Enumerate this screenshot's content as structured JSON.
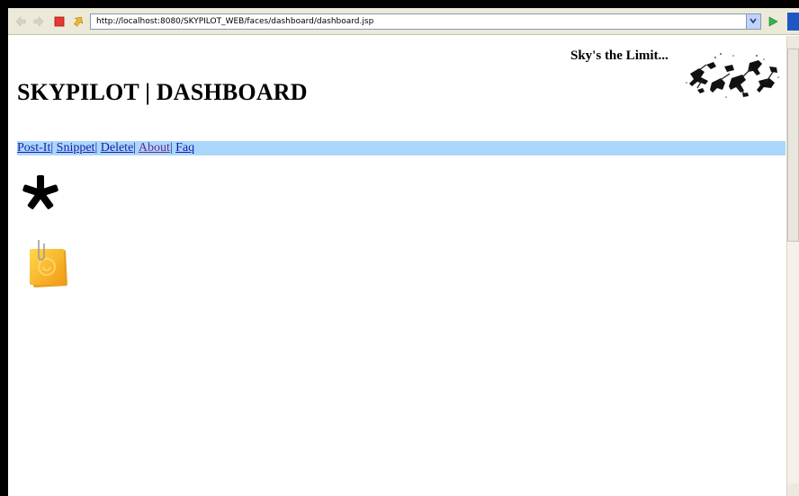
{
  "browser": {
    "address_url": "http://localhost:8080/SKYPILOT_WEB/faces/dashboard/dashboard.jsp",
    "icons": [
      "back-icon",
      "forward-icon",
      "stop-icon",
      "refresh-icon",
      "dropdown-icon",
      "go-icon"
    ]
  },
  "header": {
    "tagline": "Sky's the Limit...",
    "title": "SKYPILOT | DASHBOARD"
  },
  "nav": {
    "links": [
      {
        "label": "Post-It"
      },
      {
        "label": "Snippet"
      },
      {
        "label": "Delete"
      },
      {
        "label": "About"
      },
      {
        "label": "Faq"
      }
    ],
    "separator": "|"
  },
  "content": {
    "icons": [
      "asterisk-icon",
      "post-it-note-icon"
    ]
  },
  "colors": {
    "nav_bar_bg": "#aad7fb",
    "link": "#1a1aa6",
    "visited_link": "#6b2a8f",
    "toolbar_bg": "#ece9d8"
  }
}
